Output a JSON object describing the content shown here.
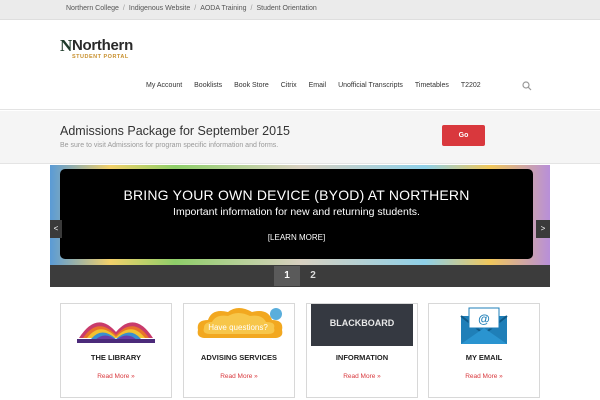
{
  "topbar": {
    "links": [
      "Northern College",
      "Indigenous Website",
      "AODA Training",
      "Student Orientation"
    ],
    "separator": "/"
  },
  "logo": {
    "mark": "N",
    "word": "Northern",
    "sub": "STUDENT PORTAL"
  },
  "nav": {
    "items": [
      "My Account",
      "Booklists",
      "Book Store",
      "Citrix",
      "Email",
      "Unofficial Transcripts",
      "Timetables",
      "T2202"
    ],
    "search_icon": "search-icon"
  },
  "announcement": {
    "title": "Admissions Package for September 2015",
    "subtitle": "Be sure to visit Admissions for program specific information and forms.",
    "button_label": "Go",
    "button_color": "#d9383d"
  },
  "slider": {
    "title": "BRING YOUR OWN DEVICE (BYOD) AT NORTHERN",
    "subtitle": "Important information for new and returning students.",
    "link_label": "[LEARN MORE]",
    "prev_label": "<",
    "next_label": ">",
    "pages": [
      "1",
      "2"
    ],
    "active_page": "1"
  },
  "cards": [
    {
      "title": "THE LIBRARY",
      "link": "Read More »",
      "image": "open-book-image"
    },
    {
      "title": "ADVISING SERVICES",
      "link": "Read More »",
      "image": "have-questions-cloud-image",
      "image_text": "Have questions?"
    },
    {
      "title": "INFORMATION",
      "link": "Read More »",
      "image": "blackboard-image",
      "image_text": "BLACKBOARD"
    },
    {
      "title": "MY EMAIL",
      "link": "Read More »",
      "image": "email-envelope-image",
      "image_text": "@"
    }
  ],
  "colors": {
    "accent": "#d9383d",
    "logo_gold": "#c8902e"
  }
}
